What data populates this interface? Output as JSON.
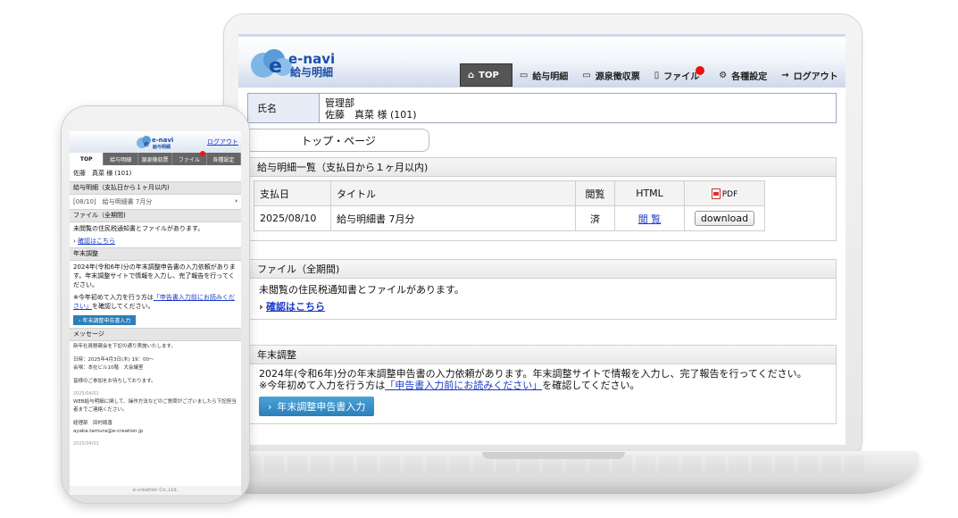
{
  "laptop": {
    "logo": {
      "brand": "e-navi",
      "sub": "給与明細"
    },
    "nav": [
      {
        "label": "TOP",
        "icon": "home-icon",
        "active": true
      },
      {
        "label": "給与明細",
        "icon": "monitor-icon"
      },
      {
        "label": "源泉徴収票",
        "icon": "monitor-icon"
      },
      {
        "label": "ファイル",
        "icon": "file-icon",
        "badge": true
      },
      {
        "label": "各種設定",
        "icon": "gear-icon"
      },
      {
        "label": "ログアウト",
        "icon": "logout-icon"
      }
    ],
    "name_label": "氏名",
    "name_dept": "管理部",
    "name_user": "佐藤　真菜 様 (101)",
    "top_tab": "トップ・ページ",
    "payslip": {
      "heading": "給与明細一覧（支払日から１ヶ月以内)",
      "columns": [
        "支払日",
        "タイトル",
        "閲覧",
        "HTML",
        "PDF"
      ],
      "rows": [
        {
          "date": "2025/08/10",
          "title": "給与明細書 7月分",
          "viewed": "済",
          "html": "閲 覧",
          "pdf": "download"
        }
      ]
    },
    "files": {
      "heading": "ファイル（全期間)",
      "text": "未閲覧の住民税通知書とファイルがあります。",
      "link": "確認はこちら"
    },
    "nenmatsu": {
      "heading": "年末調整",
      "line1": "2024年(令和6年)分の年末調整申告書の入力依頼があります。年末調整サイトで情報を入力し、完了報告を行ってください。",
      "line2_pre": "※今年初めて入力を行う方は",
      "line2_link": "「申告書入力前にお読みください」",
      "line2_post": "を確認してください。",
      "button": "年末調整申告書入力"
    }
  },
  "phone": {
    "logo": {
      "brand": "e-navi",
      "sub": "給与明細"
    },
    "logout": "ログアウト",
    "tabs": [
      "TOP",
      "給与明細",
      "源泉徴収票",
      "ファイル",
      "各種設定"
    ],
    "user": "佐藤　真菜 様 (101)",
    "payslip_heading": "給与明細（支払日から１ヶ月以内)",
    "payslip_item": "[08/10]　給与明細書 7月分",
    "files_heading": "ファイル（全期間)",
    "files_text": "未閲覧の住民税通知書とファイルがあります。",
    "files_link": "確認はこちら",
    "nenmatsu_heading": "年末調整",
    "nenmatsu_text": "2024年(令和6年)分の年末調整申告書の入力依頼があります。年末調整サイトで情報を入力し、完了報告を行ってください。",
    "nenmatsu_note_pre": "※今年初めて入力を行う方は",
    "nenmatsu_note_link": "「申告書入力前にお読みください」",
    "nenmatsu_note_post": "を確認してください。",
    "nenmatsu_button": "年末調整申告書入力",
    "message_heading": "メッセージ",
    "msg1": "新年社員懇親会を下記の通り実施いたします。",
    "msg2": "日時：2025年4月3日(木) 19：00〜",
    "msg3": "会場：本社ビル10階　大会議室",
    "msg4": "皆様のご参加をお待ちしております。",
    "msg_date1": "2025/04/01",
    "msg5": "WEB給与明細に関して、操作方法などのご質問がございましたら下記担当者までご連絡ください。",
    "msg6": "経理部　田村綾香",
    "msg7": "ayaka.tamura@e-creation.jp",
    "msg_date2": "2025/04/01",
    "footer": "e-creation Co.,Ltd."
  }
}
